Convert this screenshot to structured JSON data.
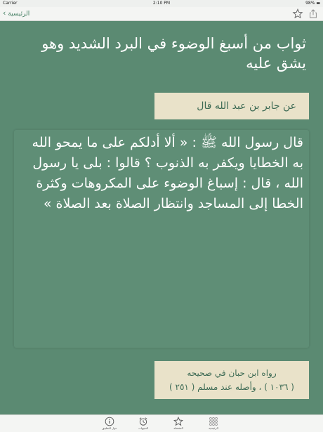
{
  "status_bar": {
    "carrier": "Carrier",
    "time": "2:10 PM",
    "battery": "98%"
  },
  "navbar": {
    "back_label": "الرئيسية"
  },
  "hadith_card": {
    "title": "ثواب من أسبغ الوضوء في البرد الشديد وهو يشق عليه",
    "narrator": "عن جابر بن عبد الله قال",
    "text": "قال رسول الله ﷺ : « ألا أدلكم على ما يمحو الله به الخطايا ويكفر به الذنوب ؟ قالوا : بلى يا رسول الله ، قال : إسباغ الوضوء على المكروهات وكثرة الخطا إلى المساجد وانتظار الصلاة بعد الصلاة »",
    "source_line1": "رواه ابن حبان في صحيحه",
    "source_line2": "( ١٠٣٦ ) ، وأصله عند مسلم ( ٢٥١ )"
  },
  "tabbar": {
    "items": [
      {
        "label": "حول التطبيق",
        "icon": "info-icon"
      },
      {
        "label": "التنبيهات",
        "icon": "alarm-clock-icon"
      },
      {
        "label": "المفضلة",
        "icon": "star-icon"
      },
      {
        "label": "الرئيسية",
        "icon": "grid-icon"
      }
    ]
  },
  "colors": {
    "background": "#5b8a72",
    "card": "#e9e2c9",
    "accent": "#3c7a5c"
  }
}
